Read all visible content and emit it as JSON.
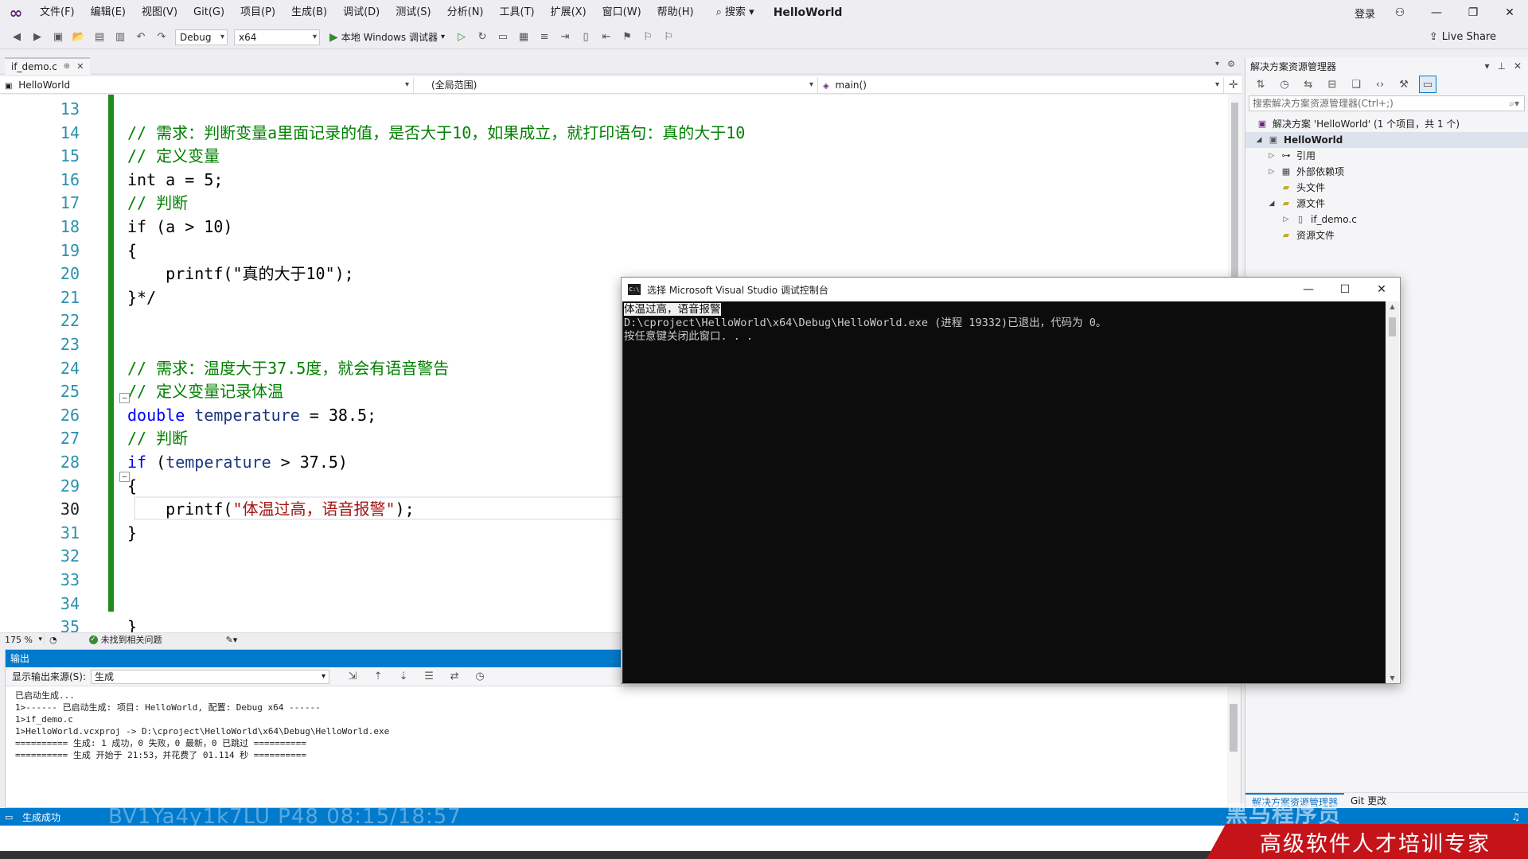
{
  "titlebar": {
    "menus": [
      "文件(F)",
      "编辑(E)",
      "视图(V)",
      "Git(G)",
      "项目(P)",
      "生成(B)",
      "调试(D)",
      "测试(S)",
      "分析(N)",
      "工具(T)",
      "扩展(X)",
      "窗口(W)",
      "帮助(H)"
    ],
    "search_label": "搜索",
    "solution_name": "HelloWorld",
    "login_label": "登录"
  },
  "toolbar": {
    "config": "Debug",
    "platform": "x64",
    "run_label": "本地 Windows 调试器",
    "live_share": "Live Share"
  },
  "editor": {
    "tab_name": "if_demo.c",
    "nav_project": "HelloWorld",
    "nav_scope": "(全局范围)",
    "nav_function": "main()",
    "zoom": "175 %",
    "issues": "未找到相关问题",
    "current_line": 30,
    "line_numbers": [
      13,
      14,
      15,
      16,
      17,
      18,
      19,
      20,
      21,
      22,
      23,
      24,
      25,
      26,
      27,
      28,
      29,
      30,
      31,
      32,
      33,
      34,
      35
    ],
    "lines": [
      [],
      [
        [
          "c",
          "// 需求：判断变量a里面记录的值，是否大于10，如果成立，就打印语句：真的大于10"
        ]
      ],
      [
        [
          "c",
          "// 定义变量"
        ]
      ],
      [
        [
          "",
          "int a = 5;"
        ]
      ],
      [
        [
          "c",
          "// 判断"
        ]
      ],
      [
        [
          "",
          "if (a > 10)"
        ]
      ],
      [
        [
          "",
          "{"
        ]
      ],
      [
        [
          "",
          "    printf(\"真的大于10\");"
        ]
      ],
      [
        [
          "",
          "}*/"
        ]
      ],
      [],
      [],
      [
        [
          "c",
          "// 需求：温度大于37.5度，就会有语音警告"
        ]
      ],
      [
        [
          "c",
          "// 定义变量记录体温"
        ]
      ],
      [
        [
          "k",
          "double"
        ],
        [
          "",
          " "
        ],
        [
          "v",
          "temperature"
        ],
        [
          "",
          " = 38.5;"
        ]
      ],
      [
        [
          "c",
          "// 判断"
        ]
      ],
      [
        [
          "k",
          "if"
        ],
        [
          "",
          " ("
        ],
        [
          "v",
          "temperature"
        ],
        [
          "",
          " > 37.5)"
        ]
      ],
      [
        [
          "",
          "{"
        ]
      ],
      [
        [
          "",
          "    printf("
        ],
        [
          "s",
          "\"体温过高，语音报警\""
        ],
        [
          "",
          ");"
        ]
      ],
      [
        [
          "",
          "}"
        ]
      ],
      [],
      [],
      [],
      [
        [
          "",
          "}"
        ]
      ]
    ]
  },
  "output": {
    "title": "输出",
    "source_label": "显示输出来源(S):",
    "source_value": "生成",
    "lines": [
      "已启动生成...",
      "1>------ 已启动生成: 项目: HelloWorld, 配置: Debug x64 ------",
      "1>if_demo.c",
      "1>HelloWorld.vcxproj -> D:\\cproject\\HelloWorld\\x64\\Debug\\HelloWorld.exe",
      "========== 生成: 1 成功，0 失败，0 最新，0 已跳过 ==========",
      "========== 生成 开始于 21:53，并花费了 01.114 秒 =========="
    ]
  },
  "solution_explorer": {
    "title": "解决方案资源管理器",
    "search_placeholder": "搜索解决方案资源管理器(Ctrl+;)",
    "tree": {
      "solution": "解决方案 'HelloWorld' (1 个项目，共 1 个)",
      "project": "HelloWorld",
      "references": "引用",
      "external_deps": "外部依赖项",
      "headers": "头文件",
      "sources": "源文件",
      "source_file": "if_demo.c",
      "resources": "资源文件"
    },
    "tab_explorer": "解决方案资源管理器",
    "tab_git": "Git 更改"
  },
  "console": {
    "title": "选择 Microsoft Visual Studio 调试控制台",
    "selected_line": "体温过高，语音报警",
    "line2": "D:\\cproject\\HelloWorld\\x64\\Debug\\HelloWorld.exe (进程 19332)已退出，代码为 0。",
    "line3": "按任意键关闭此窗口. . ."
  },
  "statusbar": {
    "text": "生成成功",
    "watermark": "BV1Ya4y1k7LU P48 08:15/18:57"
  },
  "brand": {
    "slogan": "高级软件人才培训专家",
    "logo": "黑马程序员"
  },
  "colors": {
    "accent": "#007acc",
    "comment": "#008000",
    "keyword": "#0000ff",
    "string": "#a31515",
    "change_bar": "#1f8a1f",
    "brand_red": "#c4141a"
  }
}
